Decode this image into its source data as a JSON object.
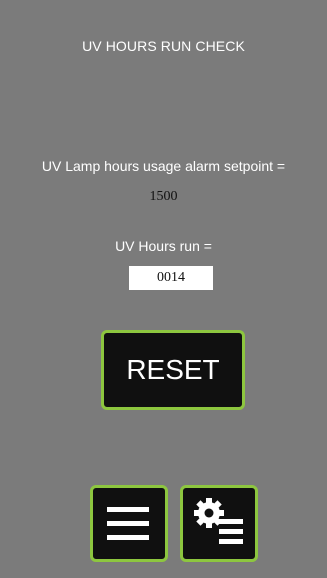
{
  "screen": {
    "title": "UV HOURS RUN CHECK",
    "setpoint_label": "UV Lamp hours usage alarm setpoint =",
    "setpoint_value": "1500",
    "hours_run_label": "UV Hours run =",
    "hours_run_value": "0014"
  },
  "buttons": {
    "reset_label": "RESET",
    "menu_icon": "hamburger-menu-icon",
    "settings_icon": "gear-list-settings-icon"
  },
  "colors": {
    "background": "#7b7b7b",
    "button_fill": "#101010",
    "button_border": "#8dc63f",
    "text": "#ffffff"
  }
}
